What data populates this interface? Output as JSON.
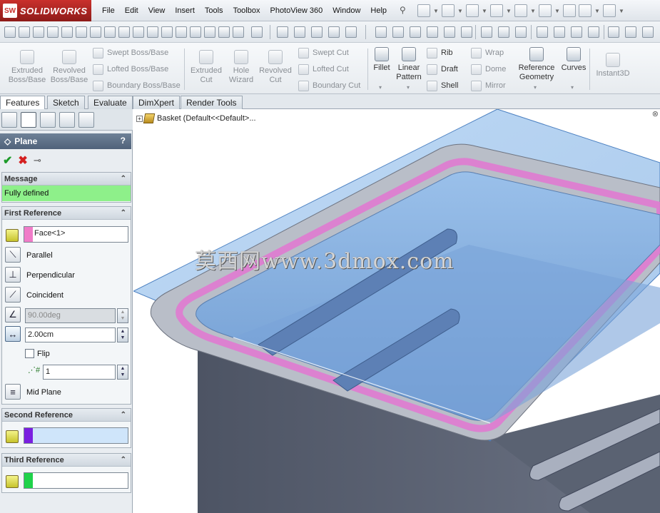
{
  "app": {
    "logo_badge": "SW",
    "logo_text": "SOLIDWORKS"
  },
  "menu": [
    "File",
    "Edit",
    "View",
    "Insert",
    "Tools",
    "Toolbox",
    "PhotoView 360",
    "Window",
    "Help"
  ],
  "command_manager": {
    "extruded_boss": "Extruded Boss/Base",
    "revolved_boss": "Revolved Boss/Base",
    "swept_boss": "Swept Boss/Base",
    "lofted_boss": "Lofted Boss/Base",
    "boundary_boss": "Boundary Boss/Base",
    "extruded_cut": "Extruded Cut",
    "hole_wizard": "Hole Wizard",
    "revolved_cut": "Revolved Cut",
    "swept_cut": "Swept Cut",
    "lofted_cut": "Lofted Cut",
    "boundary_cut": "Boundary Cut",
    "fillet": "Fillet",
    "linear_pattern": "Linear Pattern",
    "rib": "Rib",
    "draft": "Draft",
    "shell": "Shell",
    "wrap": "Wrap",
    "dome": "Dome",
    "mirror": "Mirror",
    "reference_geometry": "Reference Geometry",
    "curves": "Curves",
    "instant3d": "Instant3D"
  },
  "tabs": [
    "Features",
    "Sketch",
    "Evaluate",
    "DimXpert",
    "Render Tools"
  ],
  "property_manager": {
    "title": "Plane",
    "help": "?",
    "message": {
      "header": "Message",
      "text": "Fully defined"
    },
    "first_reference": {
      "header": "First Reference",
      "selection": "Face<1>",
      "selection_color": "#f07cc8",
      "parallel": "Parallel",
      "perpendicular": "Perpendicular",
      "coincident": "Coincident",
      "angle": "90.00deg",
      "distance": "2.00cm",
      "flip": "Flip",
      "count": "1",
      "mid_plane": "Mid Plane"
    },
    "second_reference": {
      "header": "Second Reference",
      "selection_color": "#7a1fe0"
    },
    "third_reference": {
      "header": "Third Reference",
      "selection_color": "#1fd24a"
    }
  },
  "feature_tree": {
    "root": "Basket  (Default<<Default>..."
  },
  "watermark": "莫西网www.3dmox.com",
  "colors": {
    "plane_fill": "#8fb8e6",
    "part_gray": "#5e6675",
    "highlight_pink": "#e07ad0",
    "pane_header": "#5b6d84",
    "message_green": "#8ef08a"
  }
}
